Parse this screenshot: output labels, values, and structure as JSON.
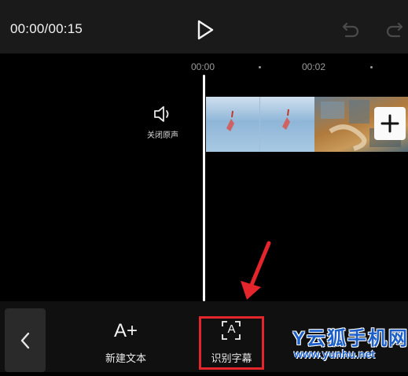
{
  "header": {
    "timecode": "00:00/00:15",
    "icons": [
      "play-icon",
      "undo-icon",
      "redo-icon"
    ]
  },
  "timeline": {
    "ruler_labels": [
      "00:00",
      "00:02"
    ],
    "mute_label": "关闭原声",
    "icons": [
      "speaker-icon",
      "plus-icon"
    ]
  },
  "toolbar": {
    "new_text_label": "新建文本",
    "new_text_icon_text": "A+",
    "auto_caption_label": "识别字幕",
    "auto_caption_icon_text": "A",
    "icons": [
      "chevron-left-icon",
      "text-add-icon",
      "caption-recognize-icon"
    ]
  },
  "annotation": {
    "highlight_color": "#e4252b"
  },
  "watermark": {
    "title": "Y云狐手机网",
    "url": "www.yunhu.net",
    "color": "#1d5fc8"
  }
}
